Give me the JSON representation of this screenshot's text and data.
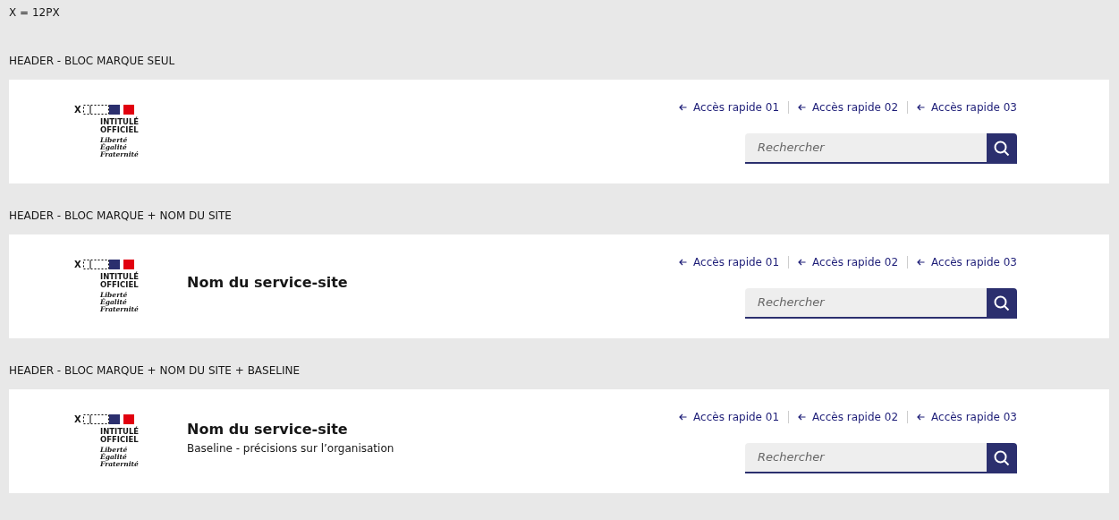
{
  "note": "X = 12PX",
  "sections": [
    {
      "title": "HEADER - BLOC MARQUE SEUL",
      "logo": {
        "marker": "X",
        "name_lines": [
          "INTITULÉ",
          "OFFICIEL"
        ],
        "motto": [
          "Liberté",
          "Égalité",
          "Fraternité"
        ]
      },
      "quick_links": [
        "Accès rapide 01",
        "Accès rapide 02",
        "Accès rapide 03"
      ],
      "search": {
        "placeholder": "Rechercher"
      }
    },
    {
      "title": "HEADER - BLOC MARQUE + NOM DU SITE",
      "logo": {
        "marker": "X",
        "name_lines": [
          "INTITULÉ",
          "OFFICIEL"
        ],
        "motto": [
          "Liberté",
          "Égalité",
          "Fraternité"
        ]
      },
      "site_name": "Nom du service-site",
      "quick_links": [
        "Accès rapide 01",
        "Accès rapide 02",
        "Accès rapide 03"
      ],
      "search": {
        "placeholder": "Rechercher"
      }
    },
    {
      "title": "HEADER - BLOC MARQUE + NOM DU SITE + BASELINE",
      "logo": {
        "marker": "X",
        "name_lines": [
          "INTITULÉ",
          "OFFICIEL"
        ],
        "motto": [
          "Liberté",
          "Égalité",
          "Fraternité"
        ]
      },
      "site_name": "Nom du service-site",
      "baseline": "Baseline - précisions sur l’organisation",
      "quick_links": [
        "Accès rapide 01",
        "Accès rapide 02",
        "Accès rapide 03"
      ],
      "search": {
        "placeholder": "Rechercher"
      }
    }
  ]
}
